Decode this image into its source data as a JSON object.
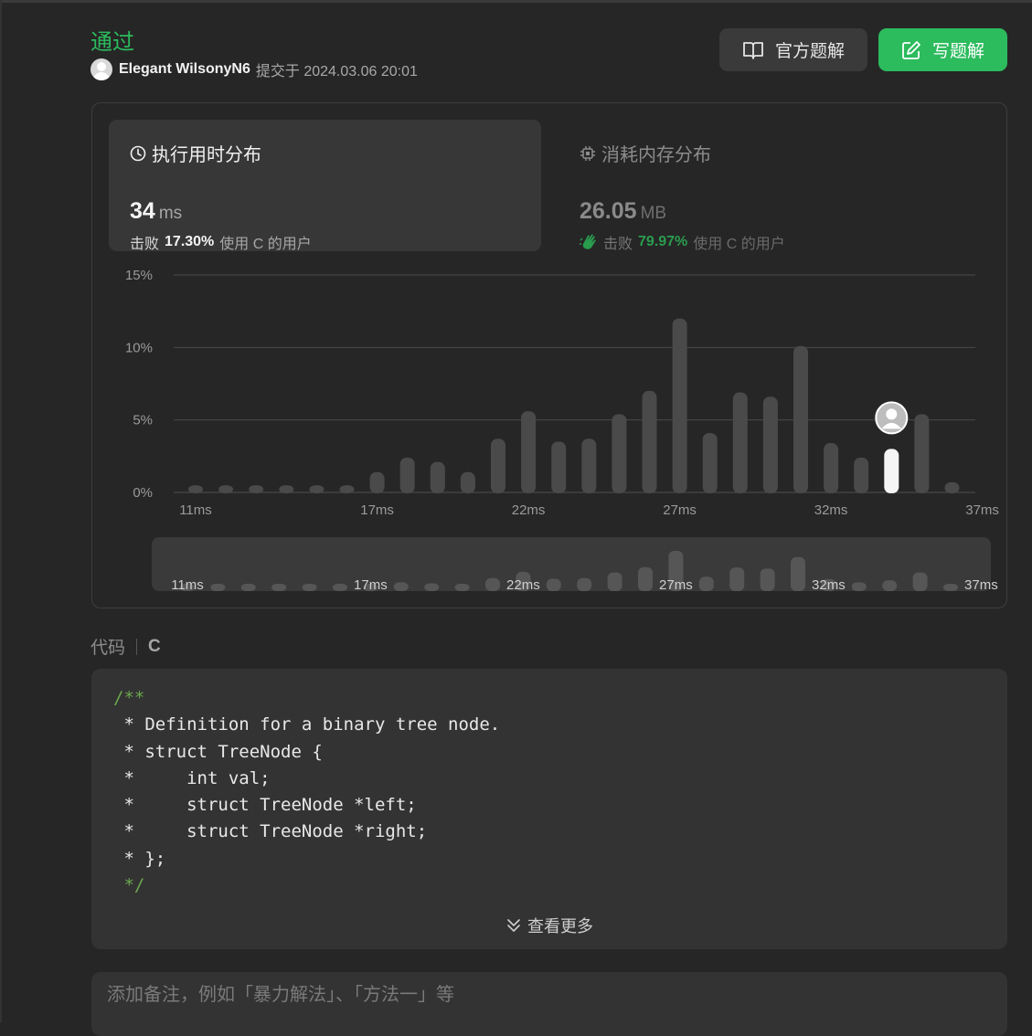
{
  "submission": {
    "status": "通过",
    "username": "Elegant WilsonyN6",
    "submitted_text": "提交于 2024.03.06 20:01"
  },
  "actions": {
    "official_solution": "官方题解",
    "write_solution": "写题解"
  },
  "runtime": {
    "title": "执行用时分布",
    "value": "34",
    "unit": "ms",
    "beats_prefix": "击败",
    "beats_percent": "17.30%",
    "beats_suffix": "使用 C 的用户"
  },
  "memory": {
    "title": "消耗内存分布",
    "value": "26.05",
    "unit": "MB",
    "beats_prefix": "击败",
    "beats_percent": "79.97%",
    "beats_suffix": "使用 C 的用户"
  },
  "colors": {
    "accent": "#2cbb5d",
    "bar": "#4a4a4a",
    "highlight": "#f5f5f5"
  },
  "chart_data": {
    "type": "bar",
    "title": "",
    "xlabel": "",
    "ylabel": "",
    "ylim": [
      0,
      15
    ],
    "yticks": [
      "0%",
      "5%",
      "10%",
      "15%"
    ],
    "xticks": [
      "11ms",
      "17ms",
      "22ms",
      "27ms",
      "32ms",
      "37ms"
    ],
    "categories": [
      "11ms",
      "12ms",
      "13ms",
      "14ms",
      "15ms",
      "16ms",
      "17ms",
      "18ms",
      "19ms",
      "20ms",
      "21ms",
      "22ms",
      "23ms",
      "24ms",
      "25ms",
      "26ms",
      "27ms",
      "28ms",
      "29ms",
      "30ms",
      "31ms",
      "32ms",
      "33ms",
      "34ms",
      "35ms",
      "36ms",
      "37ms"
    ],
    "values": [
      0.5,
      0.5,
      0.5,
      0.5,
      0.5,
      0.5,
      1.4,
      2.4,
      2.1,
      1.4,
      3.7,
      5.6,
      3.5,
      3.7,
      5.4,
      7.0,
      12.0,
      4.1,
      6.9,
      6.6,
      10.1,
      3.4,
      2.4,
      3.0,
      5.4,
      0.7
    ],
    "highlight_category": "34ms",
    "grid": true,
    "overview_xticks": [
      "11ms",
      "17ms",
      "22ms",
      "27ms",
      "32ms",
      "37ms"
    ]
  },
  "code": {
    "label": "代码",
    "language": "C",
    "more": "查看更多"
  },
  "note": {
    "placeholder": "添加备注，例如「暴力解法」、「方法一」等"
  }
}
